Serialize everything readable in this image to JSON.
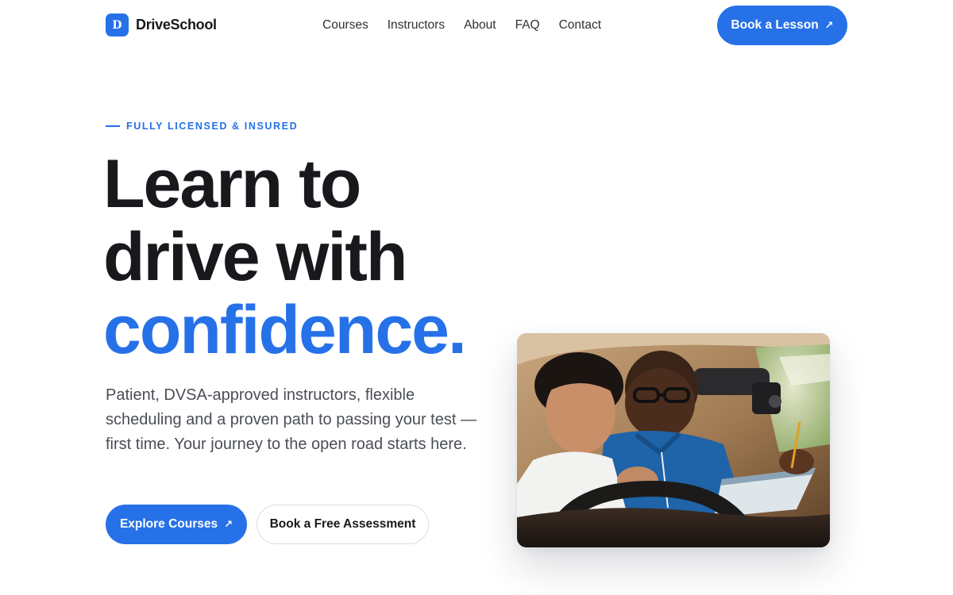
{
  "brand": {
    "logo_letter": "D",
    "name": "DriveSchool"
  },
  "nav": {
    "items": [
      {
        "label": "Courses"
      },
      {
        "label": "Instructors"
      },
      {
        "label": "About"
      },
      {
        "label": "FAQ"
      },
      {
        "label": "Contact"
      }
    ]
  },
  "header": {
    "cta_label": "Book a Lesson",
    "cta_icon": "arrow-up-right-icon"
  },
  "hero": {
    "eyebrow": "FULLY LICENSED & INSURED",
    "headline_line1": "Learn to",
    "headline_line2": "drive with",
    "headline_accent": "confidence.",
    "lead": "Patient, DVSA-approved instructors, flexible scheduling and a proven path to passing your test — first time. Your journey to the open road starts here.",
    "primary_cta": "Explore Courses",
    "secondary_cta": "Book a Free Assessment"
  },
  "photo": {
    "subject": "driving-instructor-with-student-in-car"
  },
  "colors": {
    "accent": "#2671e8",
    "text": "#17191c",
    "muted_text": "#4a4e55",
    "border": "#d9dce1",
    "background": "#ffffff"
  }
}
